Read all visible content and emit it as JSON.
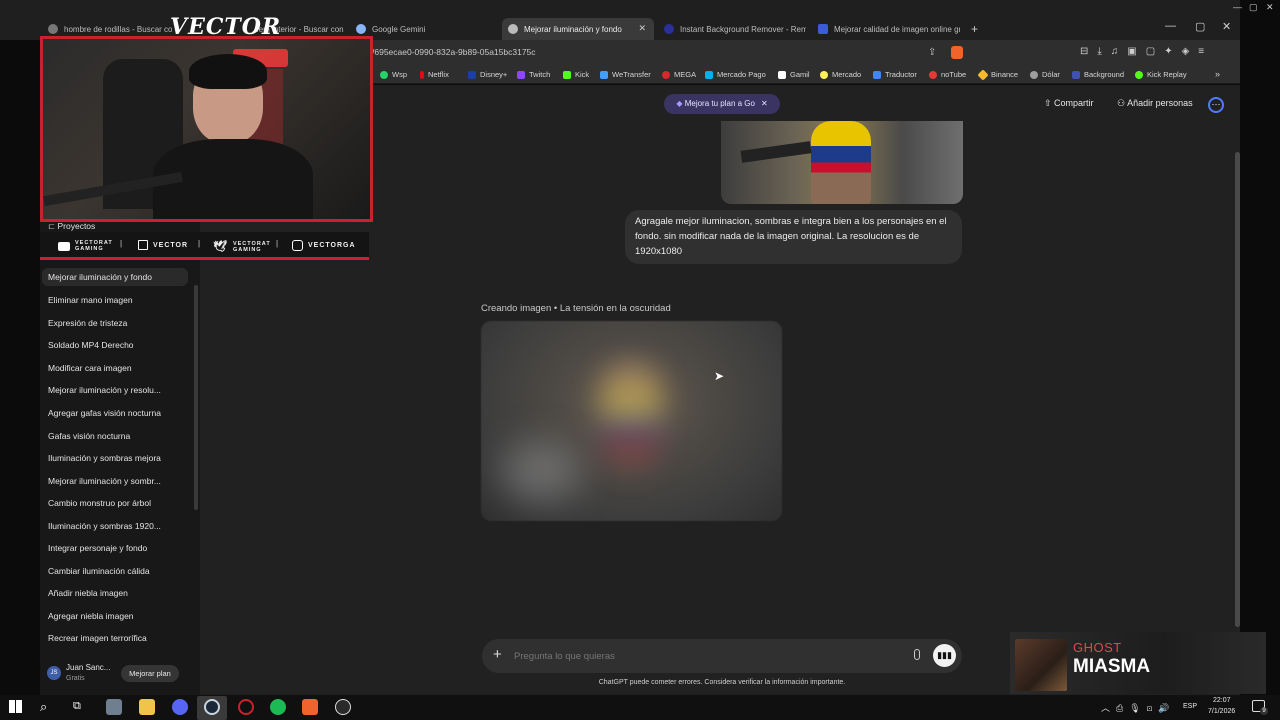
{
  "browser": {
    "tabs": [
      {
        "title": "hombre de rodillas - Buscar con Google"
      },
      {
        "title": "...em interior - Buscar con Google"
      },
      {
        "title": "Google Gemini"
      },
      {
        "title": "Mejorar iluminación y fondo",
        "active": true
      },
      {
        "title": "Instant Background Remover - Remo"
      },
      {
        "title": "Mejorar calidad de imagen online gr"
      }
    ],
    "new_tab": "+",
    "url": "/695ecae0-0990-832a-9b89-05a15bc3175c",
    "bookmarks": [
      {
        "label": "Wsp",
        "color": "#25d366"
      },
      {
        "label": "Netflix",
        "color": "#e50914"
      },
      {
        "label": "Disney+",
        "color": "#1a3fa8"
      },
      {
        "label": "Twitch",
        "color": "#9146ff"
      },
      {
        "label": "Kick",
        "color": "#53fc18"
      },
      {
        "label": "WeTransfer",
        "color": "#409fff"
      },
      {
        "label": "MEGA",
        "color": "#d9272e"
      },
      {
        "label": "Mercado Pago",
        "color": "#00b1ea"
      },
      {
        "label": "Gamil",
        "color": "#ffffff"
      },
      {
        "label": "Mercado",
        "color": "#fff159"
      },
      {
        "label": "Traductor",
        "color": "#4285f4"
      },
      {
        "label": "noTube",
        "color": "#e53935"
      },
      {
        "label": "Binance",
        "color": "#f3ba2f"
      },
      {
        "label": "Dólar",
        "color": "#9e9e9e"
      },
      {
        "label": "Background",
        "color": "#3f51b5"
      },
      {
        "label": "Kick Replay",
        "color": "#53fc18"
      }
    ]
  },
  "overlay": {
    "streamer_name": "VECTOR",
    "socials": [
      {
        "label": "VECTORAT GAMING"
      },
      {
        "label": "VECTOR"
      },
      {
        "label": "VECTORAT GAMING"
      },
      {
        "label": "VECTORGA"
      }
    ]
  },
  "sidebar": {
    "projects_label": "Proyectos",
    "chats": [
      {
        "label": "Mejorar iluminación y fondo",
        "active": true
      },
      {
        "label": "Eliminar mano imagen"
      },
      {
        "label": "Expresión de tristeza"
      },
      {
        "label": "Soldado MP4 Derecho"
      },
      {
        "label": "Modificar cara imagen"
      },
      {
        "label": "Mejorar iluminación y resolu..."
      },
      {
        "label": "Agregar gafas visión nocturna"
      },
      {
        "label": "Gafas visión nocturna"
      },
      {
        "label": "Iluminación y sombras mejora"
      },
      {
        "label": "Mejorar iluminación y sombr..."
      },
      {
        "label": "Cambio monstruo por árbol"
      },
      {
        "label": "Iluminación y sombras 1920..."
      },
      {
        "label": "Integrar personaje y fondo"
      },
      {
        "label": "Cambiar iluminación cálida"
      },
      {
        "label": "Añadir niebla imagen"
      },
      {
        "label": "Agregar niebla imagen"
      },
      {
        "label": "Recrear imagen terrorífica"
      }
    ],
    "user": {
      "initials": "JS",
      "name": "Juan Sanc...",
      "plan": "Gratis"
    },
    "upgrade_label": "Mejorar plan"
  },
  "header": {
    "upgrade_pill": "Mejora tu plan a Go",
    "share_label": "Compartir",
    "add_people_label": "Añadir personas"
  },
  "conversation": {
    "user_message": "Agragale mejor iluminacion, sombras e integra bien a los personajes en el fondo. sin modificar nada de la imagen original. La resolucion es de 1920x1080",
    "status": "Creando imagen • La tensión en la oscuridad"
  },
  "composer": {
    "plus": "+",
    "placeholder": "Pregunta lo que quieras"
  },
  "disclaimer": "ChatGPT puede cometer errores. Considera verificar la información importante.",
  "music": {
    "artist": "GHOST",
    "track": "MIASMA",
    "artist_color": "#e2474b"
  },
  "taskbar": {
    "lang": "ESP",
    "time": "22:07",
    "date": "7/1/2026",
    "notifications": "9"
  }
}
